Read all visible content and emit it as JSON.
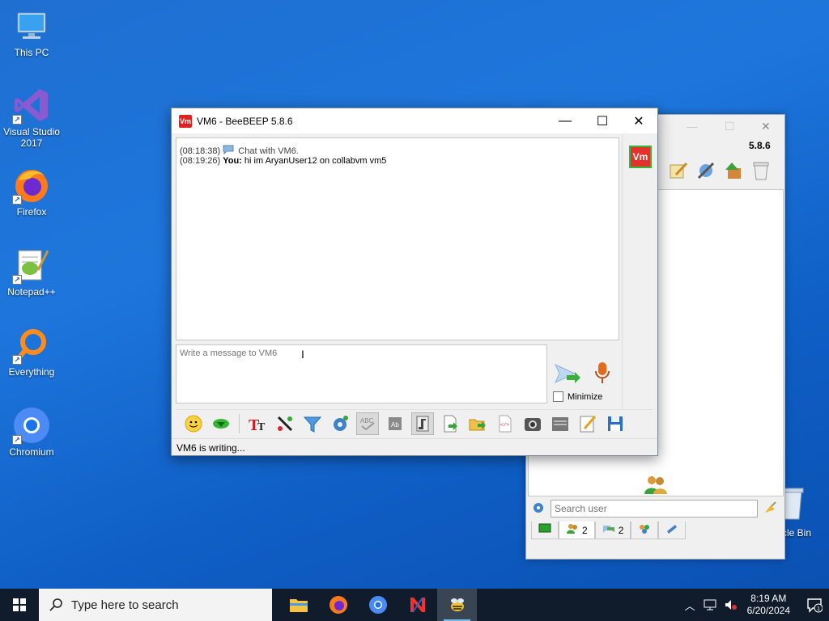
{
  "desktop": {
    "icons": [
      {
        "label": "This PC",
        "icon": "this-pc-icon"
      },
      {
        "label": "Visual Studio 2017",
        "icon": "visual-studio-icon"
      },
      {
        "label": "Firefox",
        "icon": "firefox-icon"
      },
      {
        "label": "Notepad++",
        "icon": "notepadpp-icon"
      },
      {
        "label": "Everything",
        "icon": "everything-icon"
      },
      {
        "label": "Chromium",
        "icon": "chromium-icon"
      }
    ],
    "recycle_bin_label": "cle Bin"
  },
  "main_window": {
    "version": "5.8.6",
    "search_placeholder": "Search user",
    "tabs": [
      {
        "icon": "chat-tab-icon",
        "count": ""
      },
      {
        "icon": "users-tab-icon",
        "count": "2"
      },
      {
        "icon": "groups-tab-icon",
        "count": "2"
      },
      {
        "icon": "network-tab-icon",
        "count": ""
      },
      {
        "icon": "shares-tab-icon",
        "count": ""
      }
    ]
  },
  "chat_window": {
    "title": "VM6 - BeeBEEP 5.8.6",
    "app_icon_text": "Vm",
    "messages": [
      {
        "time": "(08:18:38)",
        "sender": "",
        "text": "Chat with VM6."
      },
      {
        "time": "(08:19:26)",
        "sender": "You:",
        "text": "hi im AryanUser12 on collabvm vm5"
      }
    ],
    "input_placeholder": "Write a message to VM6",
    "minimize_label": "Minimize",
    "status": "VM6 is writing...",
    "toolbar_icons": [
      "emoticon-icon",
      "green-arrow-icon",
      "font-icon",
      "color-picker-icon",
      "filter-icon",
      "settings-icon",
      "spellcheck-icon",
      "dictionary-icon",
      "mute-icon",
      "send-file-icon",
      "send-folder-icon",
      "html-icon",
      "screenshot-icon",
      "history-icon",
      "edit-icon",
      "save-icon"
    ]
  },
  "taskbar": {
    "search_placeholder": "Type here to search",
    "time": "8:19 AM",
    "date": "6/20/2024",
    "notification_count": "1"
  },
  "colors": {
    "desktop_bg": "#1e76dc",
    "taskbar_bg": "#101b2b",
    "vm_red": "#e1322b"
  }
}
